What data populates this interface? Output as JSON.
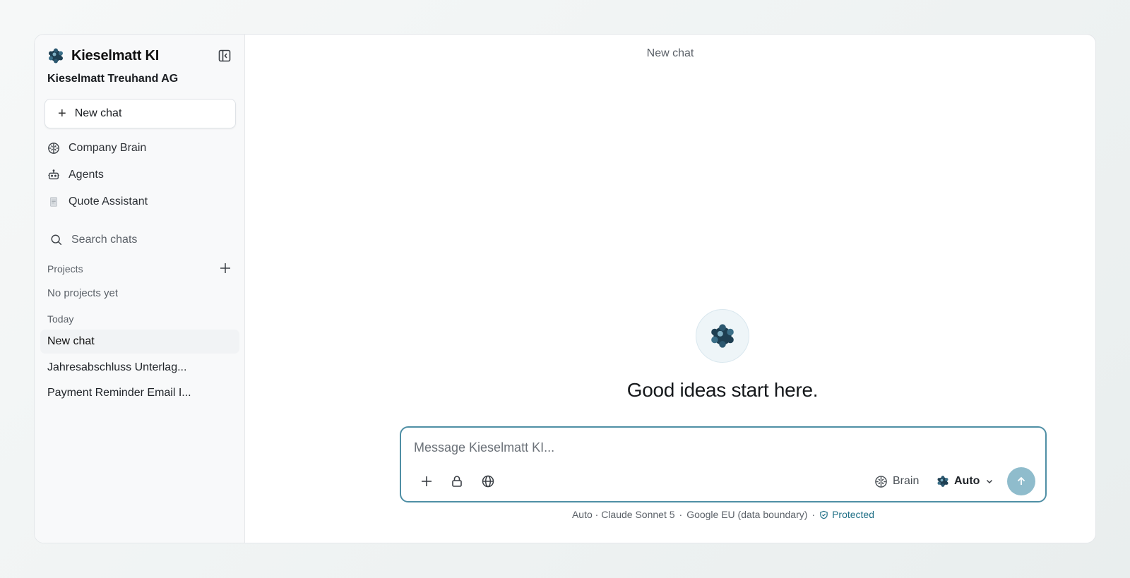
{
  "app": {
    "title": "Kieselmatt KI",
    "organization": "Kieselmatt Treuhand AG"
  },
  "sidebar": {
    "new_chat_label": "New chat",
    "nav": [
      {
        "label": "Company Brain",
        "icon": "brain-icon"
      },
      {
        "label": "Agents",
        "icon": "robot-icon"
      },
      {
        "label": "Quote Assistant",
        "icon": "document-icon"
      }
    ],
    "search_label": "Search chats",
    "projects_label": "Projects",
    "projects_empty": "No projects yet",
    "today_label": "Today",
    "chats": [
      {
        "label": "New chat",
        "active": true
      },
      {
        "label": "Jahresabschluss Unterlag..."
      },
      {
        "label": "Payment Reminder Email I..."
      }
    ]
  },
  "main": {
    "chat_title": "New chat",
    "hero_text": "Good ideas start here.",
    "composer": {
      "placeholder": "Message Kieselmatt KI...",
      "brain_label": "Brain",
      "model_label": "Auto"
    },
    "footer": {
      "model_info": "Auto · Claude Sonnet 5",
      "separator": "·",
      "region": "Google EU (data boundary)",
      "protected_label": "Protected"
    }
  },
  "colors": {
    "accent": "#4f8fa5",
    "send_button": "#8fbccc",
    "protected": "#1f6f86"
  }
}
